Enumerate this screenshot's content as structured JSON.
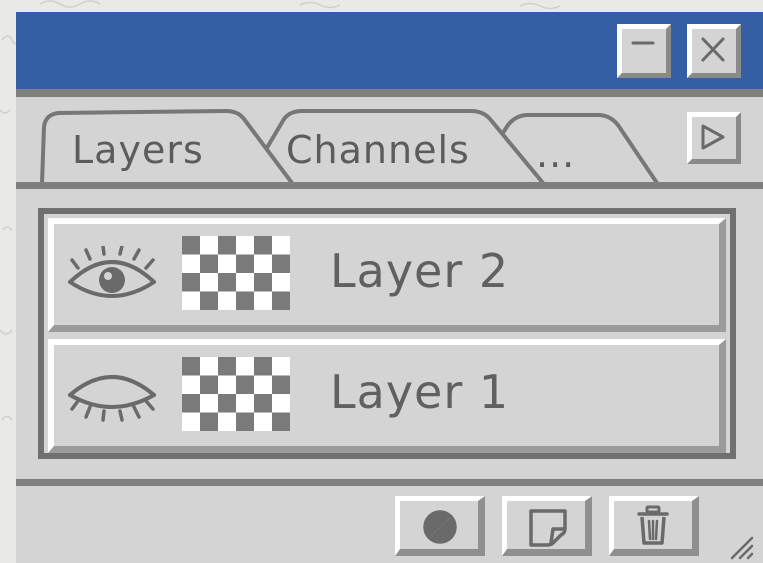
{
  "panel": {
    "window_title": "",
    "tabs": [
      {
        "label": "Layers",
        "active": true
      },
      {
        "label": "Channels",
        "active": false
      },
      {
        "label": "...",
        "active": false
      }
    ],
    "layers": [
      {
        "name": "Layer 2",
        "visible": true,
        "icon": "eye-open-icon"
      },
      {
        "name": "Layer 1",
        "visible": false,
        "icon": "eye-closed-icon"
      }
    ],
    "footer_buttons": [
      {
        "icon": "adjustment-layer-icon"
      },
      {
        "icon": "new-layer-icon"
      },
      {
        "icon": "trash-icon"
      }
    ]
  },
  "colors": {
    "titlebar": "#355fa5",
    "panel": "#d3d4d3",
    "ink": "#5c5c5c"
  }
}
